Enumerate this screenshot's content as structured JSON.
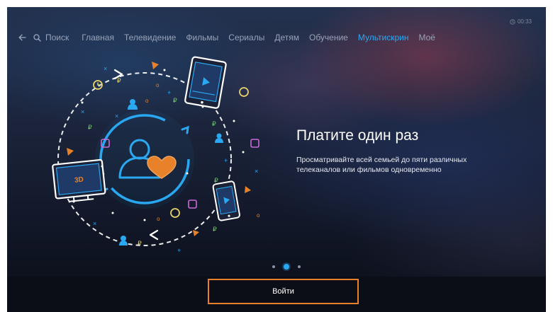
{
  "header": {
    "clock": "00:33",
    "back_icon": "arrow-left-icon",
    "search_icon": "search-icon",
    "clock_icon": "clock-icon"
  },
  "nav": {
    "items": [
      {
        "label": "Поиск",
        "active": false
      },
      {
        "label": "Главная",
        "active": false
      },
      {
        "label": "Телевидение",
        "active": false
      },
      {
        "label": "Фильмы",
        "active": false
      },
      {
        "label": "Сериалы",
        "active": false
      },
      {
        "label": "Детям",
        "active": false
      },
      {
        "label": "Обучение",
        "active": false
      },
      {
        "label": "Мультискрин",
        "active": true
      },
      {
        "label": "Моё",
        "active": false
      }
    ]
  },
  "slide": {
    "headline": "Платите один раз",
    "description": "Просматривайте всей семьей до пяти различных телеканалов или фильмов одновременно",
    "illustration": {
      "tablet_icon": "tablet-icon",
      "tv_icon": "tv-icon",
      "phone_icon": "phone-icon",
      "user_icon": "user-icon",
      "heart_icon": "heart-icon",
      "tv_screen_label": "3D"
    }
  },
  "pagination": {
    "count": 3,
    "active_index": 1
  },
  "login_button": {
    "label": "Войти"
  },
  "colors": {
    "accent": "#2aa8f2",
    "button_border": "#e8822a",
    "heart": "#e8822a",
    "nav_text": "#97a3b8"
  }
}
